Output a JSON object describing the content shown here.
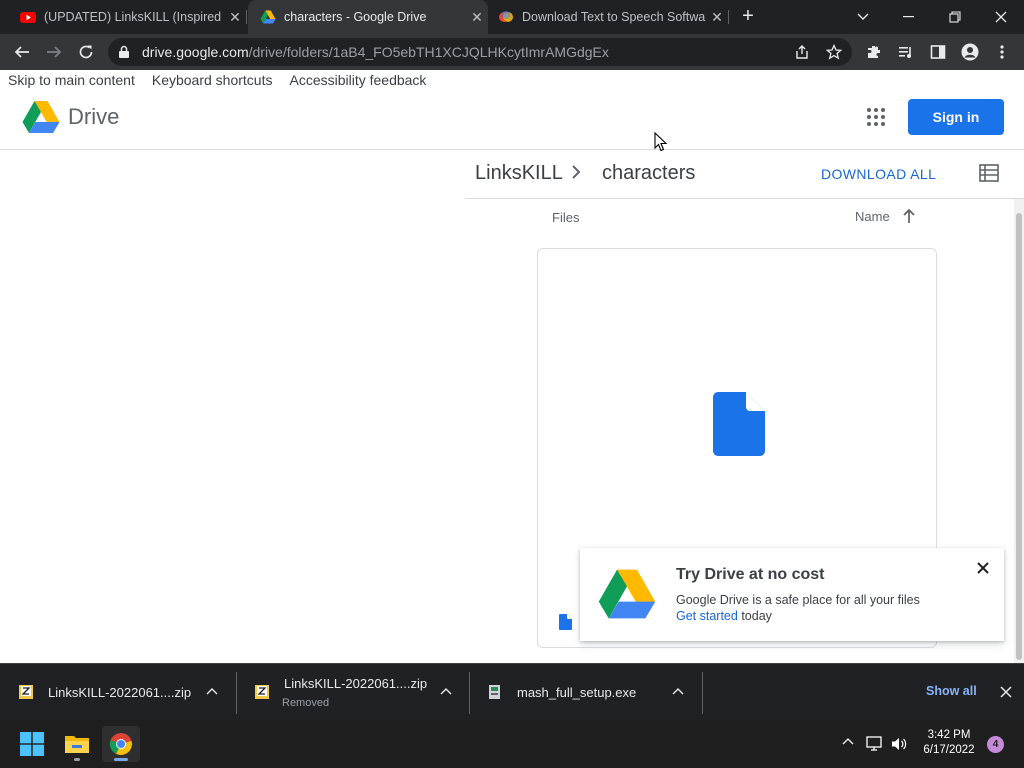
{
  "browser": {
    "tabs": [
      {
        "title": "(UPDATED) LinksKILL (Inspired By",
        "favicon": "youtube-icon",
        "active": false
      },
      {
        "title": "characters - Google Drive",
        "favicon": "google-drive-icon",
        "active": true
      },
      {
        "title": "Download Text to Speech Softwa",
        "favicon": "colorful-app-icon",
        "active": false
      }
    ],
    "url_host": "drive.google.com",
    "url_path": "/drive/folders/1aB4_FO5ebTH1XCJQLHKcytImrAMGdgEx"
  },
  "page": {
    "skip_links": [
      "Skip to main content",
      "Keyboard shortcuts",
      "Accessibility feedback"
    ],
    "logo_text": "Drive",
    "sign_in_label": "Sign in",
    "breadcrumb": {
      "parent": "LinksKILL",
      "current": "characters"
    },
    "download_all_label": "DOWNLOAD ALL",
    "files_label": "Files",
    "sort_label": "Name",
    "promo": {
      "title": "Try Drive at no cost",
      "body": "Google Drive is a safe place for all your files",
      "link": "Get started",
      "link_suffix": " today"
    }
  },
  "downloads": {
    "items": [
      {
        "name": "LinksKILL-2022061....zip",
        "status": ""
      },
      {
        "name": "LinksKILL-2022061....zip",
        "status": "Removed"
      },
      {
        "name": "mash_full_setup.exe",
        "status": ""
      }
    ],
    "show_all_label": "Show all"
  },
  "taskbar": {
    "time": "3:42 PM",
    "date": "6/17/2022",
    "notification_count": "4"
  },
  "colors": {
    "accent_blue": "#1a73e8",
    "chrome_dark": "#202124",
    "chrome_toolbar": "#35363a",
    "link_blue": "#1967d2"
  }
}
